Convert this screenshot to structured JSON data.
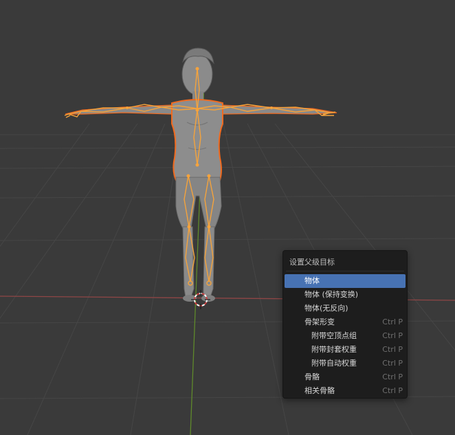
{
  "menu": {
    "title": "设置父级目标",
    "items": [
      {
        "label": "物体",
        "shortcut": "",
        "active": true,
        "indent": false
      },
      {
        "label": "物体 (保持变换)",
        "shortcut": "",
        "active": false,
        "indent": false
      },
      {
        "label": "物体(无反向)",
        "shortcut": "",
        "active": false,
        "indent": false
      },
      {
        "label": "骨架形变",
        "shortcut": "Ctrl P",
        "active": false,
        "indent": false
      },
      {
        "label": "附带空顶点组",
        "shortcut": "Ctrl P",
        "active": false,
        "indent": true
      },
      {
        "label": "附带封套权重",
        "shortcut": "Ctrl P",
        "active": false,
        "indent": true
      },
      {
        "label": "附带自动权重",
        "shortcut": "Ctrl P",
        "active": false,
        "indent": true
      },
      {
        "label": "骨骼",
        "shortcut": "Ctrl P",
        "active": false,
        "indent": false
      },
      {
        "label": "相关骨骼",
        "shortcut": "Ctrl P",
        "active": false,
        "indent": false
      }
    ]
  },
  "colors": {
    "viewport_bg": "#3a3a3a",
    "grid": "#474747",
    "x_axis": "#9a4a4a",
    "y_axis": "#6b8f2e",
    "selection_outline": "#f06a1f",
    "armature": "#f5a33c",
    "mesh": "#8a8a8a",
    "menu_bg": "#1d1d1d",
    "menu_active": "#4772b3"
  }
}
